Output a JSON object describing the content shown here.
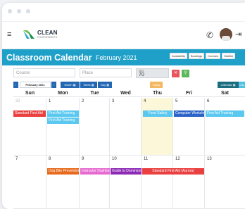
{
  "brand": {
    "name": "CLEAN",
    "tagline": "ENVIRONMENTS"
  },
  "header": {
    "title": "Classroom Calendar",
    "month": "February 2021",
    "views": [
      "Availability",
      "Bookings",
      "Courses",
      "Waitlist"
    ]
  },
  "filters": {
    "course_placeholder": "Course",
    "place_placeholder": "Place",
    "max_label": "MAX",
    "max_value": "70",
    "clear_icon": "x-icon",
    "search_icon": "search-icon"
  },
  "nav": {
    "prev": "‹",
    "next": "›",
    "period": "February 2021",
    "month_btn": "Month ▦",
    "week_btn": "Week ▦",
    "day_btn": "Day ▦",
    "today": "Today",
    "calendar": "Calendar ▦",
    "list": "List ▦"
  },
  "days": [
    "Sun",
    "Mon",
    "Tue",
    "Wed",
    "Thu",
    "Fri",
    "Sat"
  ],
  "week1": {
    "dates": [
      "31",
      "1",
      "2",
      "3",
      "4",
      "5",
      "6"
    ]
  },
  "week2": {
    "dates": [
      "7",
      "8",
      "9",
      "10",
      "11",
      "12",
      "13"
    ]
  },
  "events": {
    "e1": "Standard First Aid",
    "e2": "First Aid Training",
    "e3": "First Aid Training",
    "e4": "Food Safety",
    "e5": "Computer Workshop",
    "e6": "First Aid Training",
    "e7": "Dog Bite Prevention",
    "e8": "Instructor Dashboard",
    "e9": "Guide to Dominion",
    "e10": "Standard First Aid (Aurora)"
  },
  "colors": {
    "accent": "#1fa0c9",
    "red": "#e94040",
    "lightblue": "#5bc8f0",
    "blue": "#2b63c8",
    "orange": "#e76a1c",
    "pink": "#e66bd0",
    "purple": "#8e2bb5",
    "today": "#fdf7d9"
  }
}
